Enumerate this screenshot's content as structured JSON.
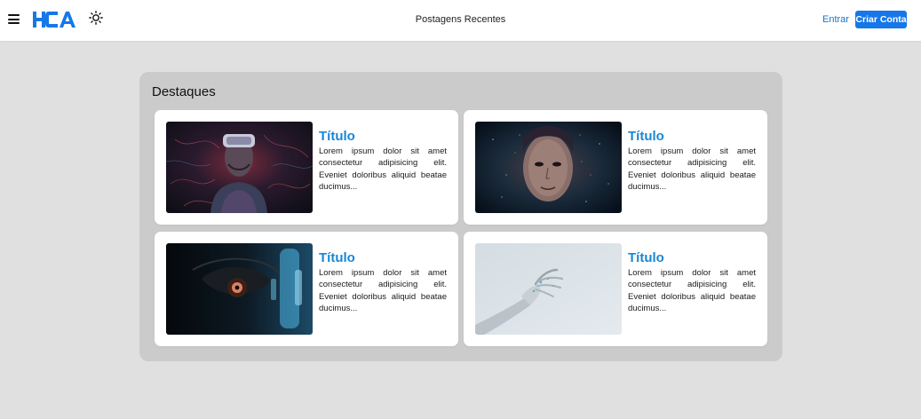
{
  "header": {
    "title": "Postagens Recentes",
    "login_label": "Entrar",
    "signup_label": "Criar Conta",
    "logo_text": "HCA",
    "icons": [
      "menu-icon",
      "sun-icon"
    ],
    "accent_color": "#1677e8"
  },
  "featured": {
    "heading": "Destaques",
    "cards": [
      {
        "title": "Título",
        "text": "Lorem ipsum dolor sit amet consectetur adipisicing elit. Eveniet doloribus aliquid beatae ducimus...",
        "image": "vr-headset-person"
      },
      {
        "title": "Título",
        "text": "Lorem ipsum dolor sit amet consectetur adipisicing elit. Eveniet doloribus aliquid beatae ducimus...",
        "image": "digital-face"
      },
      {
        "title": "Título",
        "text": "Lorem ipsum dolor sit amet consectetur adipisicing elit. Eveniet doloribus aliquid beatae ducimus...",
        "image": "cyber-eye"
      },
      {
        "title": "Título",
        "text": "Lorem ipsum dolor sit amet consectetur adipisicing elit. Eveniet doloribus aliquid beatae ducimus...",
        "image": "robot-hand"
      }
    ]
  }
}
